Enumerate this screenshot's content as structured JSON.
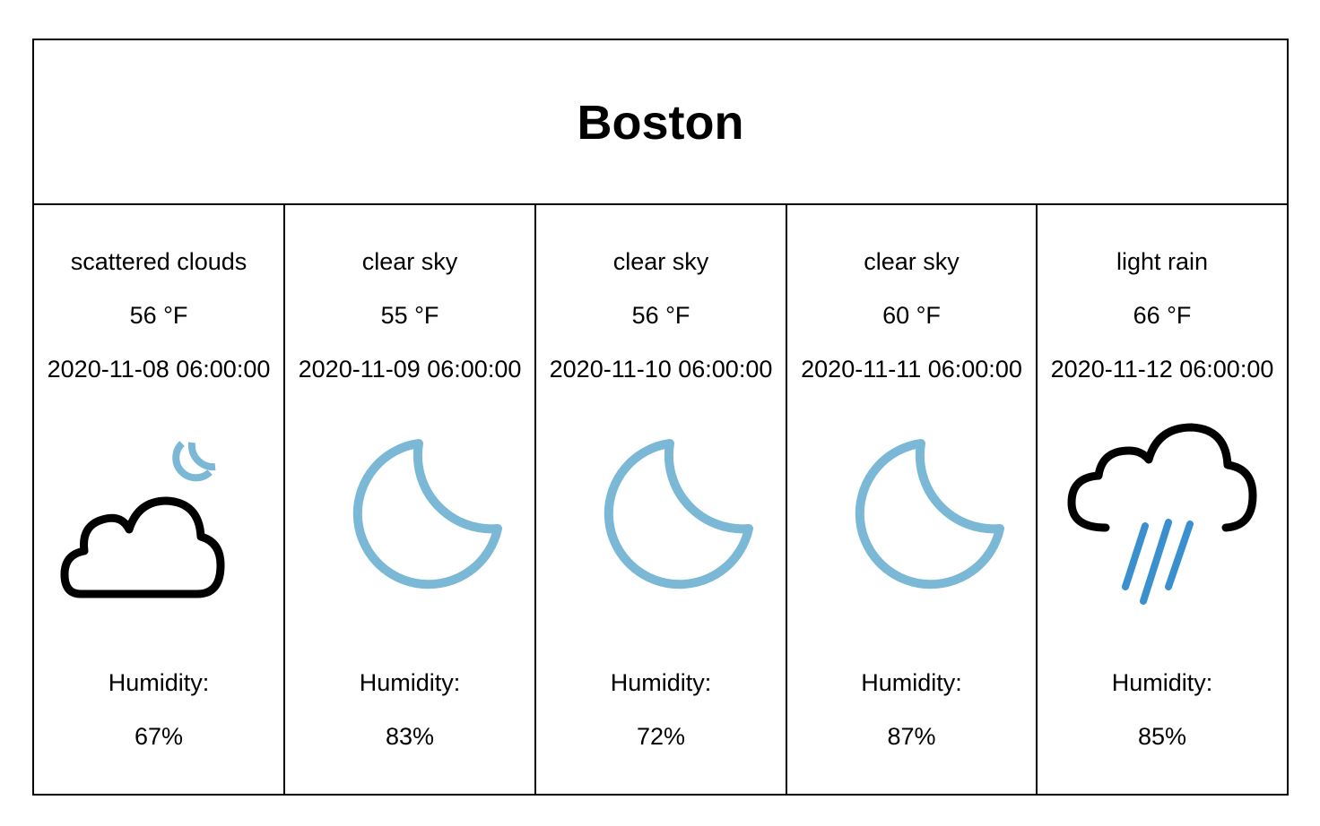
{
  "city": "Boston",
  "colors": {
    "moon": "#7ab8d6",
    "rain": "#3a8fcf",
    "cloud": "#000000"
  },
  "days": [
    {
      "description": "scattered clouds",
      "temp": "56 °F",
      "datetime": "2020-11-08 06:00:00",
      "icon": "cloud-moon-icon",
      "humidity_label": "Humidity:",
      "humidity": "67%"
    },
    {
      "description": "clear sky",
      "temp": "55 °F",
      "datetime": "2020-11-09 06:00:00",
      "icon": "moon-icon",
      "humidity_label": "Humidity:",
      "humidity": "83%"
    },
    {
      "description": "clear sky",
      "temp": "56 °F",
      "datetime": "2020-11-10 06:00:00",
      "icon": "moon-icon",
      "humidity_label": "Humidity:",
      "humidity": "72%"
    },
    {
      "description": "clear sky",
      "temp": "60 °F",
      "datetime": "2020-11-11 06:00:00",
      "icon": "moon-icon",
      "humidity_label": "Humidity:",
      "humidity": "87%"
    },
    {
      "description": "light rain",
      "temp": "66 °F",
      "datetime": "2020-11-12 06:00:00",
      "icon": "cloud-rain-icon",
      "humidity_label": "Humidity:",
      "humidity": "85%"
    }
  ]
}
